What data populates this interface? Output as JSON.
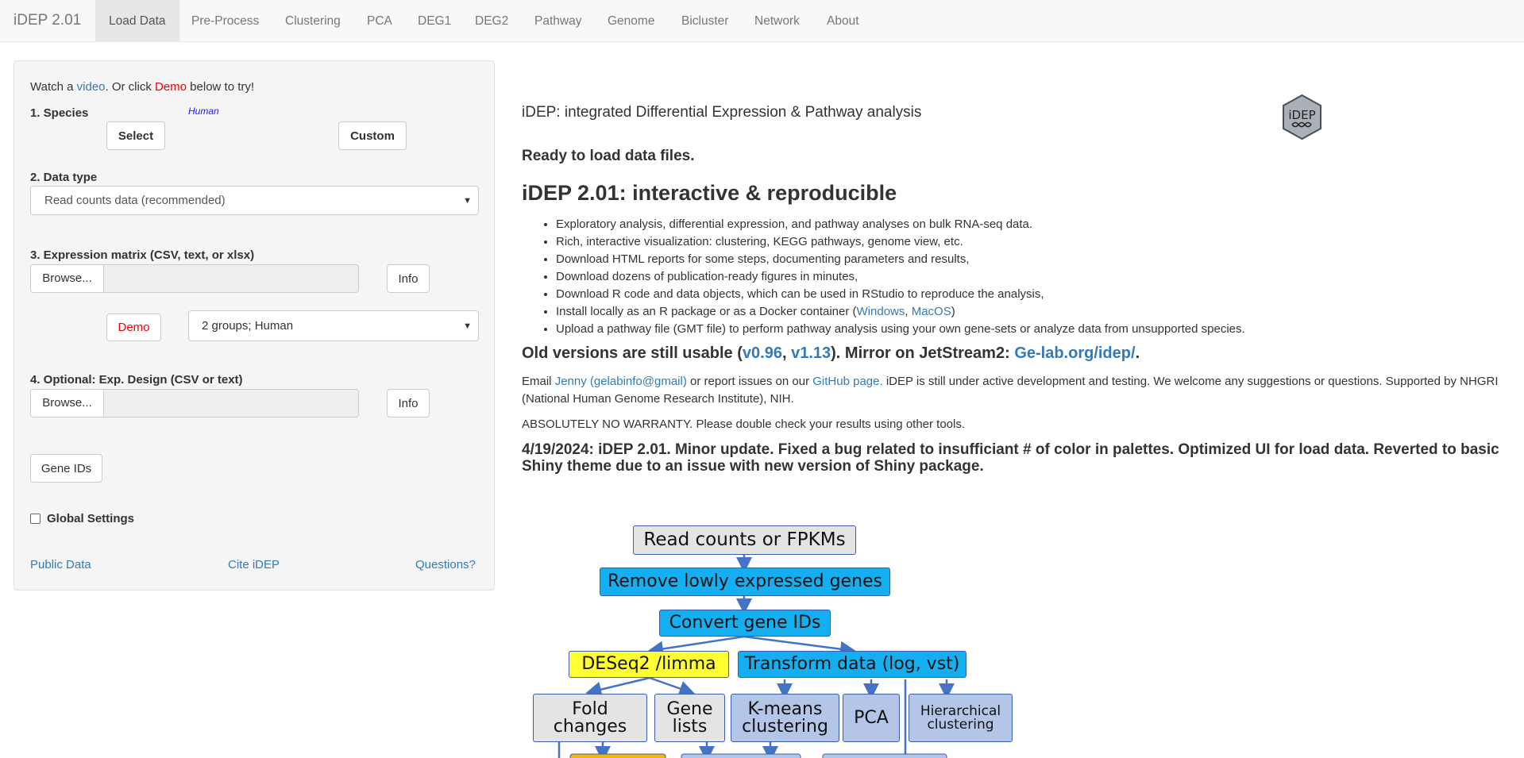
{
  "navbar": {
    "brand": "iDEP 2.01",
    "tabs": [
      "Load Data",
      "Pre-Process",
      "Clustering",
      "PCA",
      "DEG1",
      "DEG2",
      "Pathway",
      "Genome",
      "Bicluster",
      "Network",
      "About"
    ],
    "active_tab": "Load Data"
  },
  "sidebar": {
    "intro": {
      "watch": "Watch a ",
      "video": "video",
      "or_click": ". Or click ",
      "demo": "Demo",
      "below": " below to try!"
    },
    "species": {
      "label": "1. Species",
      "selected": "Human",
      "select_btn": "Select",
      "custom_btn": "Custom"
    },
    "data_type": {
      "label": "2. Data type",
      "selected": "Read counts data (recommended)"
    },
    "expr_matrix": {
      "label": "3. Expression matrix (CSV, text, or xlsx)",
      "browse": "Browse...",
      "info": "Info",
      "demo_btn": "Demo",
      "demo_select": "2 groups; Human"
    },
    "exp_design": {
      "label": "4. Optional: Exp. Design (CSV or text)",
      "browse": "Browse...",
      "info": "Info"
    },
    "gene_ids_btn": "Gene IDs",
    "global_settings": "Global Settings",
    "footer_links": {
      "public_data": "Public Data",
      "cite": "Cite iDEP",
      "questions": "Questions?"
    }
  },
  "main": {
    "subtitle": "iDEP: integrated Differential Expression & Pathway analysis",
    "logo_text": "iDEP",
    "status": "Ready to load data files.",
    "heading": "iDEP 2.01: interactive & reproducible",
    "features": [
      "Exploratory analysis, differential expression, and pathway analyses on bulk RNA-seq data.",
      "Rich, interactive visualization: clustering, KEGG pathways, genome view, etc.",
      "Download HTML reports for some steps, documenting parameters and results,",
      "Download dozens of publication-ready figures in minutes,",
      "Download R code and data objects, which can be used in RStudio to reproduce the analysis,"
    ],
    "install": {
      "pre": "Install locally as an R package or as a Docker container (",
      "windows": "Windows",
      "sep": ", ",
      "macos": "MacOS",
      "post": ")"
    },
    "pathway_item": "Upload a pathway file (GMT file) to perform pathway analysis using your own gene-sets or analyze data from unsupported species.",
    "old_versions": {
      "pre": "Old versions are still usable (",
      "v096": "v0.96",
      "comma": ", ",
      "v113": "v1.13",
      "mid": "). Mirror on JetStream2: ",
      "mirror": "Ge-lab.org/idep/",
      "post": "."
    },
    "contact": {
      "email_pre": "Email ",
      "jenny": "Jenny (gelabinfo@gmail)",
      "mid": " or report issues on our ",
      "github": "GitHub page.",
      "rest": " iDEP is still under active development and testing. We welcome any suggestions or questions. Supported by NHGRI (National Human Genome Research Institute), NIH."
    },
    "warranty": "ABSOLUTELY NO WARRANTY. Please double check your results using other tools.",
    "update_news": "4/19/2024: iDEP 2.01. Minor update. Fixed a bug related to insufficiant # of color in palettes. Optimized UI for load data. Reverted to basic Shiny theme due to an issue with new version of Shiny package."
  },
  "flowchart": {
    "read_counts": "Read counts or FPKMs",
    "remove_low": "Remove lowly expressed genes",
    "convert_ids": "Convert gene IDs",
    "deseq": "DESeq2 /limma",
    "transform": "Transform data (log, vst)",
    "fold_changes": [
      "Fold",
      "changes"
    ],
    "gene_lists": [
      "Gene",
      "lists"
    ],
    "kmeans": [
      "K-means",
      "clustering"
    ],
    "pca": "PCA",
    "hierarchical": [
      "Hierarchical",
      "clustering"
    ],
    "colors": {
      "gray": "#e4e4e4",
      "cyan": "#13aff0",
      "yellow": "#ffff33",
      "lightblue": "#b4c6e7",
      "line": "#4472c4"
    }
  }
}
